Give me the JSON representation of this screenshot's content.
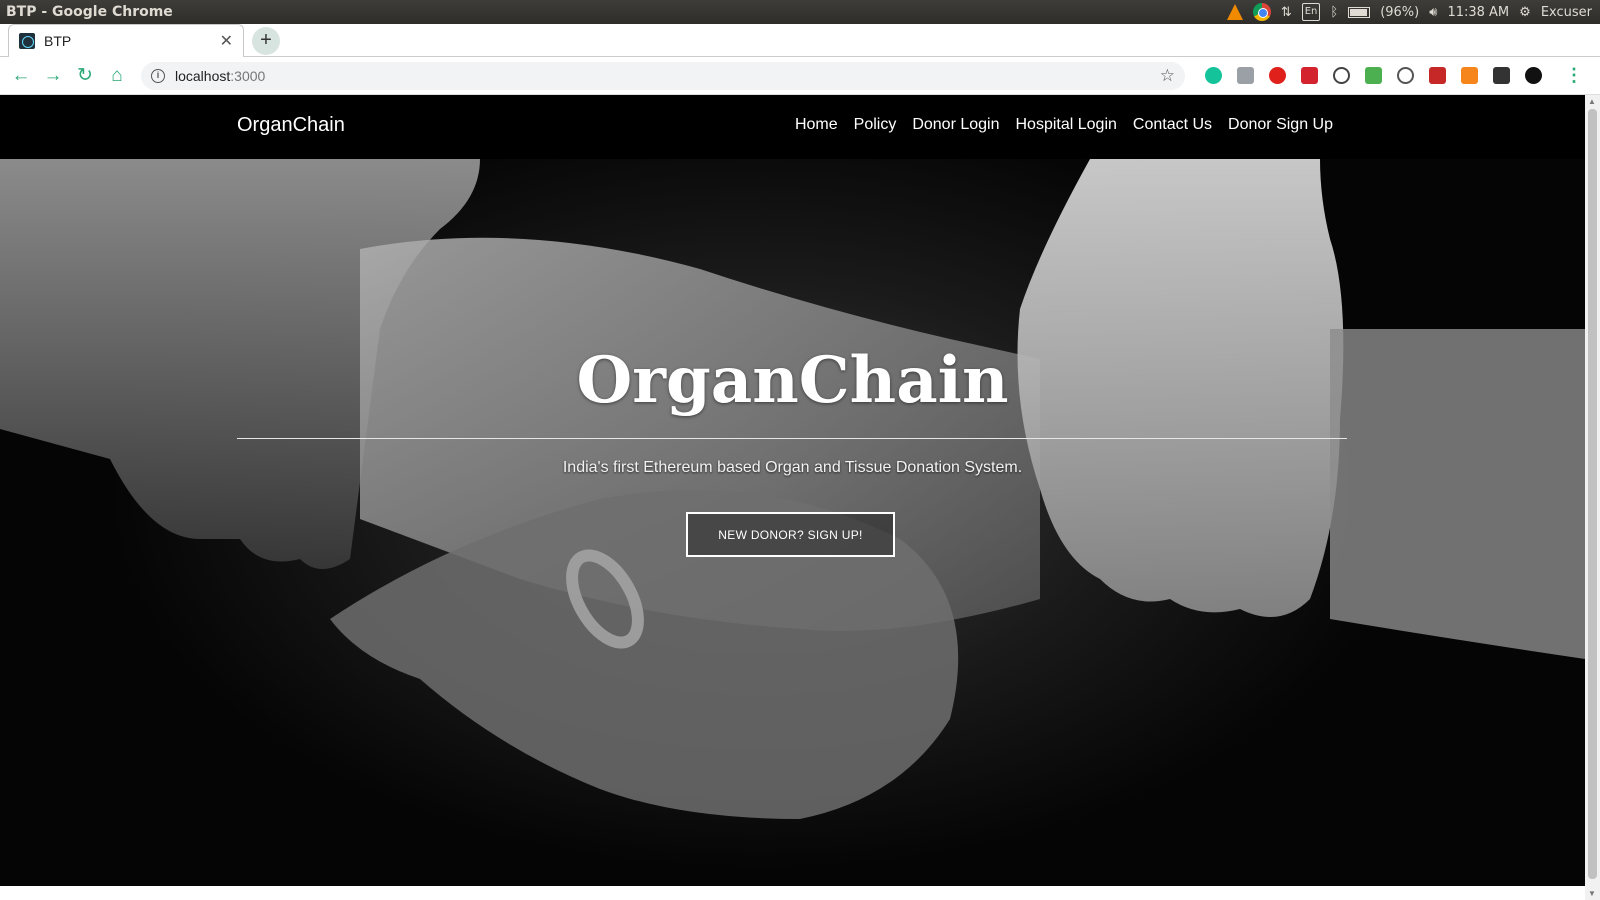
{
  "system_bar": {
    "window_title": "BTP - Google Chrome",
    "input_lang": "En",
    "battery": "(96%)",
    "time": "11:38 AM",
    "user": "Excuser"
  },
  "browser": {
    "tab_title": "BTP",
    "new_tab_symbol": "+",
    "url_host": "localhost",
    "url_port": ":3000",
    "extensions": [
      "grammarly-icon",
      "cart-icon",
      "opera-icon",
      "pdf-icon",
      "speedometer-icon",
      "inbox-icon",
      "dev-tools-icon",
      "puzzle-icon",
      "metamask-icon",
      "cube-icon",
      "profile-icon"
    ]
  },
  "site": {
    "brand": "OrganChain",
    "nav": [
      "Home",
      "Policy",
      "Donor Login",
      "Hospital Login",
      "Contact Us",
      "Donor Sign Up"
    ],
    "hero": {
      "title": "OrganChain",
      "subtitle": "India's first Ethereum based Organ and Tissue Donation System.",
      "cta": "NEW DONOR? SIGN UP!"
    }
  },
  "colors": {
    "browser_accent": "#2aa876",
    "navbar_bg": "#000000",
    "hero_text": "#ffffff"
  }
}
